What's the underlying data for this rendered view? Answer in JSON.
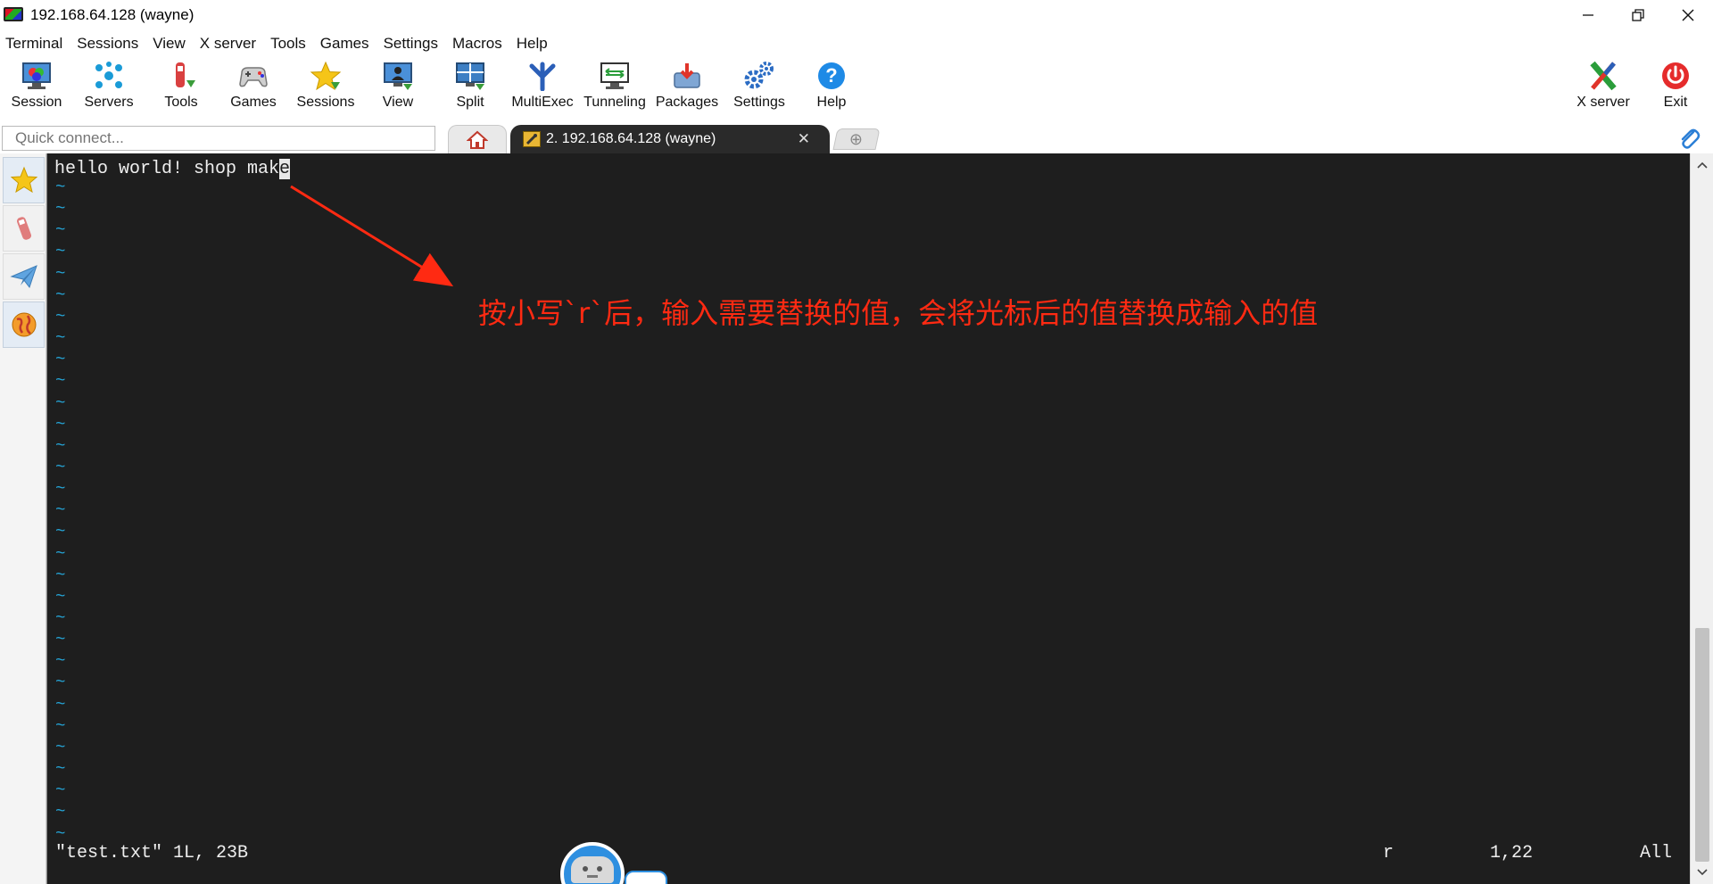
{
  "window": {
    "title": "192.168.64.128 (wayne)",
    "controls": {
      "minimize": "—",
      "restore": "❐",
      "close": "✕"
    }
  },
  "menu": [
    "Terminal",
    "Sessions",
    "View",
    "X server",
    "Tools",
    "Games",
    "Settings",
    "Macros",
    "Help"
  ],
  "toolbar": {
    "session": "Session",
    "servers": "Servers",
    "tools": "Tools",
    "games": "Games",
    "sessions": "Sessions",
    "view": "View",
    "split": "Split",
    "multiexec": "MultiExec",
    "tunneling": "Tunneling",
    "packages": "Packages",
    "settings": "Settings",
    "help": "Help",
    "xserver": "X server",
    "exit": "Exit"
  },
  "tabs": {
    "quick_connect_placeholder": "Quick connect...",
    "active_tab_label": "2. 192.168.64.128 (wayne)",
    "close_glyph": "✕",
    "new_tab_glyph": "⊕"
  },
  "terminal": {
    "first_line_text": "hello world! shop mak",
    "cursor_char": "e",
    "tilde": "~",
    "status_file": "\"test.txt\" 1L, 23B",
    "status_cmd": "r",
    "status_pos": "1,22",
    "status_scroll": "All"
  },
  "annotation": {
    "text": "按小写`r`后，输入需要替换的值，会将光标后的值替换成输入的值",
    "color": "#ff2a12"
  },
  "colors": {
    "terminal_bg": "#1e1e1e",
    "tilde": "#25a4d6",
    "tab_active_bg": "#2a2a2a",
    "accent_blue": "#2b7fd6"
  },
  "icons": {
    "title_app": "mobaxterm-icon",
    "sidebar": [
      "star-icon",
      "tools-icon",
      "send-icon",
      "globe-icon"
    ]
  }
}
